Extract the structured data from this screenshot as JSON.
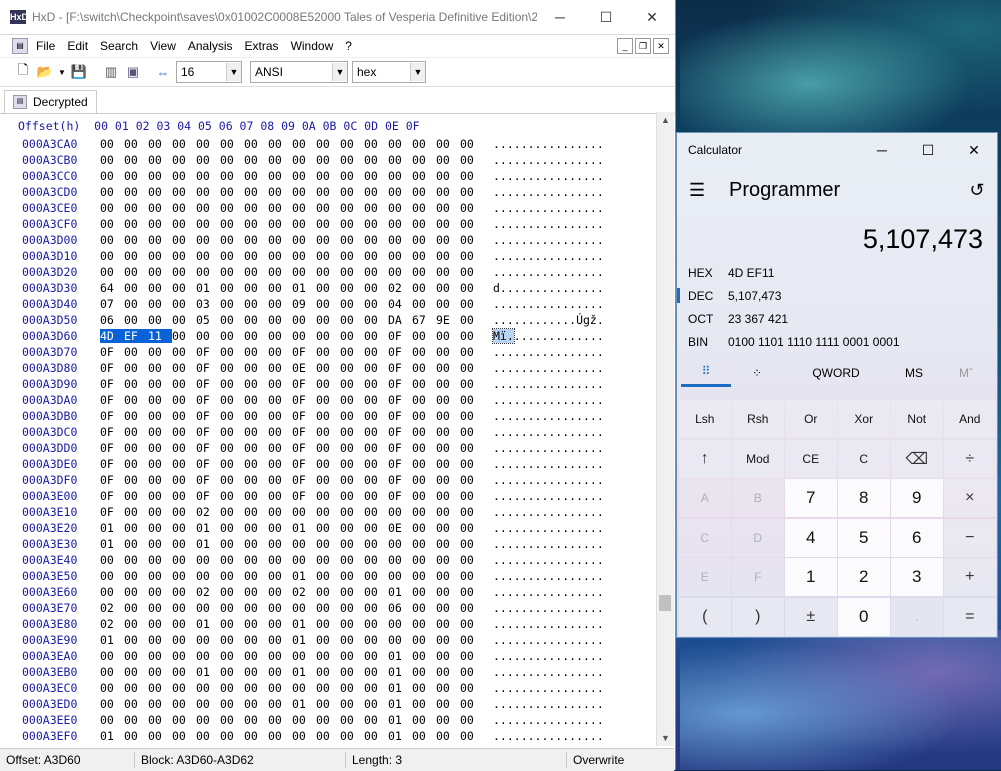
{
  "hxd": {
    "title": "HxD - [F:\\switch\\Checkpoint\\saves\\0x01002C0008E52000 Tales of Vesperia  Definitive Edition\\2...",
    "app_icon": "HxD",
    "menu": [
      "File",
      "Edit",
      "Search",
      "View",
      "Analysis",
      "Extras",
      "Window",
      "?"
    ],
    "toolbar": {
      "bytes_per_row": "16",
      "charset": "ANSI",
      "offset_base": "hex"
    },
    "tab_label": "Decrypted",
    "header": "Offset(h)  00 01 02 03 04 05 06 07 08 09 0A 0B 0C 0D 0E 0F",
    "rows": [
      {
        "off": "000A3CA0",
        "b": [
          "00",
          "00",
          "00",
          "00",
          "00",
          "00",
          "00",
          "00",
          "00",
          "00",
          "00",
          "00",
          "00",
          "00",
          "00",
          "00"
        ],
        "asc": "................"
      },
      {
        "off": "000A3CB0",
        "b": [
          "00",
          "00",
          "00",
          "00",
          "00",
          "00",
          "00",
          "00",
          "00",
          "00",
          "00",
          "00",
          "00",
          "00",
          "00",
          "00"
        ],
        "asc": "................"
      },
      {
        "off": "000A3CC0",
        "b": [
          "00",
          "00",
          "00",
          "00",
          "00",
          "00",
          "00",
          "00",
          "00",
          "00",
          "00",
          "00",
          "00",
          "00",
          "00",
          "00"
        ],
        "asc": "................"
      },
      {
        "off": "000A3CD0",
        "b": [
          "00",
          "00",
          "00",
          "00",
          "00",
          "00",
          "00",
          "00",
          "00",
          "00",
          "00",
          "00",
          "00",
          "00",
          "00",
          "00"
        ],
        "asc": "................"
      },
      {
        "off": "000A3CE0",
        "b": [
          "00",
          "00",
          "00",
          "00",
          "00",
          "00",
          "00",
          "00",
          "00",
          "00",
          "00",
          "00",
          "00",
          "00",
          "00",
          "00"
        ],
        "asc": "................"
      },
      {
        "off": "000A3CF0",
        "b": [
          "00",
          "00",
          "00",
          "00",
          "00",
          "00",
          "00",
          "00",
          "00",
          "00",
          "00",
          "00",
          "00",
          "00",
          "00",
          "00"
        ],
        "asc": "................"
      },
      {
        "off": "000A3D00",
        "b": [
          "00",
          "00",
          "00",
          "00",
          "00",
          "00",
          "00",
          "00",
          "00",
          "00",
          "00",
          "00",
          "00",
          "00",
          "00",
          "00"
        ],
        "asc": "................"
      },
      {
        "off": "000A3D10",
        "b": [
          "00",
          "00",
          "00",
          "00",
          "00",
          "00",
          "00",
          "00",
          "00",
          "00",
          "00",
          "00",
          "00",
          "00",
          "00",
          "00"
        ],
        "asc": "................"
      },
      {
        "off": "000A3D20",
        "b": [
          "00",
          "00",
          "00",
          "00",
          "00",
          "00",
          "00",
          "00",
          "00",
          "00",
          "00",
          "00",
          "00",
          "00",
          "00",
          "00"
        ],
        "asc": "................"
      },
      {
        "off": "000A3D30",
        "b": [
          "64",
          "00",
          "00",
          "00",
          "01",
          "00",
          "00",
          "00",
          "01",
          "00",
          "00",
          "00",
          "02",
          "00",
          "00",
          "00"
        ],
        "asc": "d..............."
      },
      {
        "off": "000A3D40",
        "b": [
          "07",
          "00",
          "00",
          "00",
          "03",
          "00",
          "00",
          "00",
          "09",
          "00",
          "00",
          "00",
          "04",
          "00",
          "00",
          "00"
        ],
        "asc": "................"
      },
      {
        "off": "000A3D50",
        "b": [
          "06",
          "00",
          "00",
          "00",
          "05",
          "00",
          "00",
          "00",
          "00",
          "00",
          "00",
          "00",
          "DA",
          "67",
          "9E",
          "00"
        ],
        "asc": "............Úgž."
      },
      {
        "off": "000A3D60",
        "b": [
          "4D",
          "EF",
          "11",
          "00",
          "00",
          "00",
          "00",
          "00",
          "00",
          "00",
          "00",
          "00",
          "0F",
          "00",
          "00",
          "00"
        ],
        "asc_hl": "Mï.",
        "asc_rest": ".............",
        "hl": 3
      },
      {
        "off": "000A3D70",
        "b": [
          "0F",
          "00",
          "00",
          "00",
          "0F",
          "00",
          "00",
          "00",
          "0F",
          "00",
          "00",
          "00",
          "0F",
          "00",
          "00",
          "00"
        ],
        "asc": "................"
      },
      {
        "off": "000A3D80",
        "b": [
          "0F",
          "00",
          "00",
          "00",
          "0F",
          "00",
          "00",
          "00",
          "0E",
          "00",
          "00",
          "00",
          "0F",
          "00",
          "00",
          "00"
        ],
        "asc": "................"
      },
      {
        "off": "000A3D90",
        "b": [
          "0F",
          "00",
          "00",
          "00",
          "0F",
          "00",
          "00",
          "00",
          "0F",
          "00",
          "00",
          "00",
          "0F",
          "00",
          "00",
          "00"
        ],
        "asc": "................"
      },
      {
        "off": "000A3DA0",
        "b": [
          "0F",
          "00",
          "00",
          "00",
          "0F",
          "00",
          "00",
          "00",
          "0F",
          "00",
          "00",
          "00",
          "0F",
          "00",
          "00",
          "00"
        ],
        "asc": "................"
      },
      {
        "off": "000A3DB0",
        "b": [
          "0F",
          "00",
          "00",
          "00",
          "0F",
          "00",
          "00",
          "00",
          "0F",
          "00",
          "00",
          "00",
          "0F",
          "00",
          "00",
          "00"
        ],
        "asc": "................"
      },
      {
        "off": "000A3DC0",
        "b": [
          "0F",
          "00",
          "00",
          "00",
          "0F",
          "00",
          "00",
          "00",
          "0F",
          "00",
          "00",
          "00",
          "0F",
          "00",
          "00",
          "00"
        ],
        "asc": "................"
      },
      {
        "off": "000A3DD0",
        "b": [
          "0F",
          "00",
          "00",
          "00",
          "0F",
          "00",
          "00",
          "00",
          "0F",
          "00",
          "00",
          "00",
          "0F",
          "00",
          "00",
          "00"
        ],
        "asc": "................"
      },
      {
        "off": "000A3DE0",
        "b": [
          "0F",
          "00",
          "00",
          "00",
          "0F",
          "00",
          "00",
          "00",
          "0F",
          "00",
          "00",
          "00",
          "0F",
          "00",
          "00",
          "00"
        ],
        "asc": "................"
      },
      {
        "off": "000A3DF0",
        "b": [
          "0F",
          "00",
          "00",
          "00",
          "0F",
          "00",
          "00",
          "00",
          "0F",
          "00",
          "00",
          "00",
          "0F",
          "00",
          "00",
          "00"
        ],
        "asc": "................"
      },
      {
        "off": "000A3E00",
        "b": [
          "0F",
          "00",
          "00",
          "00",
          "0F",
          "00",
          "00",
          "00",
          "0F",
          "00",
          "00",
          "00",
          "0F",
          "00",
          "00",
          "00"
        ],
        "asc": "................"
      },
      {
        "off": "000A3E10",
        "b": [
          "0F",
          "00",
          "00",
          "00",
          "02",
          "00",
          "00",
          "00",
          "00",
          "00",
          "00",
          "00",
          "00",
          "00",
          "00",
          "00"
        ],
        "asc": "................"
      },
      {
        "off": "000A3E20",
        "b": [
          "01",
          "00",
          "00",
          "00",
          "01",
          "00",
          "00",
          "00",
          "01",
          "00",
          "00",
          "00",
          "0E",
          "00",
          "00",
          "00"
        ],
        "asc": "................"
      },
      {
        "off": "000A3E30",
        "b": [
          "01",
          "00",
          "00",
          "00",
          "01",
          "00",
          "00",
          "00",
          "00",
          "00",
          "00",
          "00",
          "00",
          "00",
          "00",
          "00"
        ],
        "asc": "................"
      },
      {
        "off": "000A3E40",
        "b": [
          "00",
          "00",
          "00",
          "00",
          "00",
          "00",
          "00",
          "00",
          "00",
          "00",
          "00",
          "00",
          "00",
          "00",
          "00",
          "00"
        ],
        "asc": "................"
      },
      {
        "off": "000A3E50",
        "b": [
          "00",
          "00",
          "00",
          "00",
          "00",
          "00",
          "00",
          "00",
          "01",
          "00",
          "00",
          "00",
          "00",
          "00",
          "00",
          "00"
        ],
        "asc": "................"
      },
      {
        "off": "000A3E60",
        "b": [
          "00",
          "00",
          "00",
          "00",
          "02",
          "00",
          "00",
          "00",
          "02",
          "00",
          "00",
          "00",
          "01",
          "00",
          "00",
          "00"
        ],
        "asc": "................"
      },
      {
        "off": "000A3E70",
        "b": [
          "02",
          "00",
          "00",
          "00",
          "00",
          "00",
          "00",
          "00",
          "00",
          "00",
          "00",
          "00",
          "06",
          "00",
          "00",
          "00"
        ],
        "asc": "................"
      },
      {
        "off": "000A3E80",
        "b": [
          "02",
          "00",
          "00",
          "00",
          "01",
          "00",
          "00",
          "00",
          "01",
          "00",
          "00",
          "00",
          "00",
          "00",
          "00",
          "00"
        ],
        "asc": "................"
      },
      {
        "off": "000A3E90",
        "b": [
          "01",
          "00",
          "00",
          "00",
          "00",
          "00",
          "00",
          "00",
          "01",
          "00",
          "00",
          "00",
          "00",
          "00",
          "00",
          "00"
        ],
        "asc": "................"
      },
      {
        "off": "000A3EA0",
        "b": [
          "00",
          "00",
          "00",
          "00",
          "00",
          "00",
          "00",
          "00",
          "00",
          "00",
          "00",
          "00",
          "01",
          "00",
          "00",
          "00"
        ],
        "asc": "................"
      },
      {
        "off": "000A3EB0",
        "b": [
          "00",
          "00",
          "00",
          "00",
          "01",
          "00",
          "00",
          "00",
          "01",
          "00",
          "00",
          "00",
          "01",
          "00",
          "00",
          "00"
        ],
        "asc": "................"
      },
      {
        "off": "000A3EC0",
        "b": [
          "00",
          "00",
          "00",
          "00",
          "00",
          "00",
          "00",
          "00",
          "00",
          "00",
          "00",
          "00",
          "01",
          "00",
          "00",
          "00"
        ],
        "asc": "................"
      },
      {
        "off": "000A3ED0",
        "b": [
          "00",
          "00",
          "00",
          "00",
          "00",
          "00",
          "00",
          "00",
          "01",
          "00",
          "00",
          "00",
          "01",
          "00",
          "00",
          "00"
        ],
        "asc": "................"
      },
      {
        "off": "000A3EE0",
        "b": [
          "00",
          "00",
          "00",
          "00",
          "00",
          "00",
          "00",
          "00",
          "00",
          "00",
          "00",
          "00",
          "01",
          "00",
          "00",
          "00"
        ],
        "asc": "................"
      },
      {
        "off": "000A3EF0",
        "b": [
          "01",
          "00",
          "00",
          "00",
          "00",
          "00",
          "00",
          "00",
          "00",
          "00",
          "00",
          "00",
          "01",
          "00",
          "00",
          "00"
        ],
        "asc": "................"
      }
    ],
    "status": {
      "offset": "Offset: A3D60",
      "block": "Block: A3D60-A3D62",
      "length": "Length: 3",
      "mode": "Overwrite"
    }
  },
  "calc": {
    "title": "Calculator",
    "mode": "Programmer",
    "display": "5,107,473",
    "radix": [
      {
        "label": "HEX",
        "value": "4D EF11"
      },
      {
        "label": "DEC",
        "value": "5,107,473"
      },
      {
        "label": "OCT",
        "value": "23 367 421"
      },
      {
        "label": "BIN",
        "value": "0100 1101 1110 1111 0001 0001"
      }
    ],
    "tabs": {
      "word": "QWORD",
      "ms": "MS",
      "mr": "Mˇ"
    },
    "keys": [
      {
        "t": "Lsh",
        "c": ""
      },
      {
        "t": "Rsh",
        "c": ""
      },
      {
        "t": "Or",
        "c": ""
      },
      {
        "t": "Xor",
        "c": ""
      },
      {
        "t": "Not",
        "c": ""
      },
      {
        "t": "And",
        "c": ""
      },
      {
        "t": "↑",
        "c": "op"
      },
      {
        "t": "Mod",
        "c": ""
      },
      {
        "t": "CE",
        "c": ""
      },
      {
        "t": "C",
        "c": ""
      },
      {
        "t": "⌫",
        "c": "op"
      },
      {
        "t": "÷",
        "c": "op"
      },
      {
        "t": "A",
        "c": "dis"
      },
      {
        "t": "B",
        "c": "dis"
      },
      {
        "t": "7",
        "c": "num"
      },
      {
        "t": "8",
        "c": "num"
      },
      {
        "t": "9",
        "c": "num"
      },
      {
        "t": "×",
        "c": "op"
      },
      {
        "t": "C",
        "c": "dis"
      },
      {
        "t": "D",
        "c": "dis"
      },
      {
        "t": "4",
        "c": "num"
      },
      {
        "t": "5",
        "c": "num"
      },
      {
        "t": "6",
        "c": "num"
      },
      {
        "t": "−",
        "c": "op"
      },
      {
        "t": "E",
        "c": "dis"
      },
      {
        "t": "F",
        "c": "dis"
      },
      {
        "t": "1",
        "c": "num"
      },
      {
        "t": "2",
        "c": "num"
      },
      {
        "t": "3",
        "c": "num"
      },
      {
        "t": "+",
        "c": "op"
      },
      {
        "t": "(",
        "c": "op"
      },
      {
        "t": ")",
        "c": "op"
      },
      {
        "t": "±",
        "c": "op"
      },
      {
        "t": "0",
        "c": "num"
      },
      {
        "t": ".",
        "c": "dis"
      },
      {
        "t": "=",
        "c": "op"
      }
    ]
  }
}
